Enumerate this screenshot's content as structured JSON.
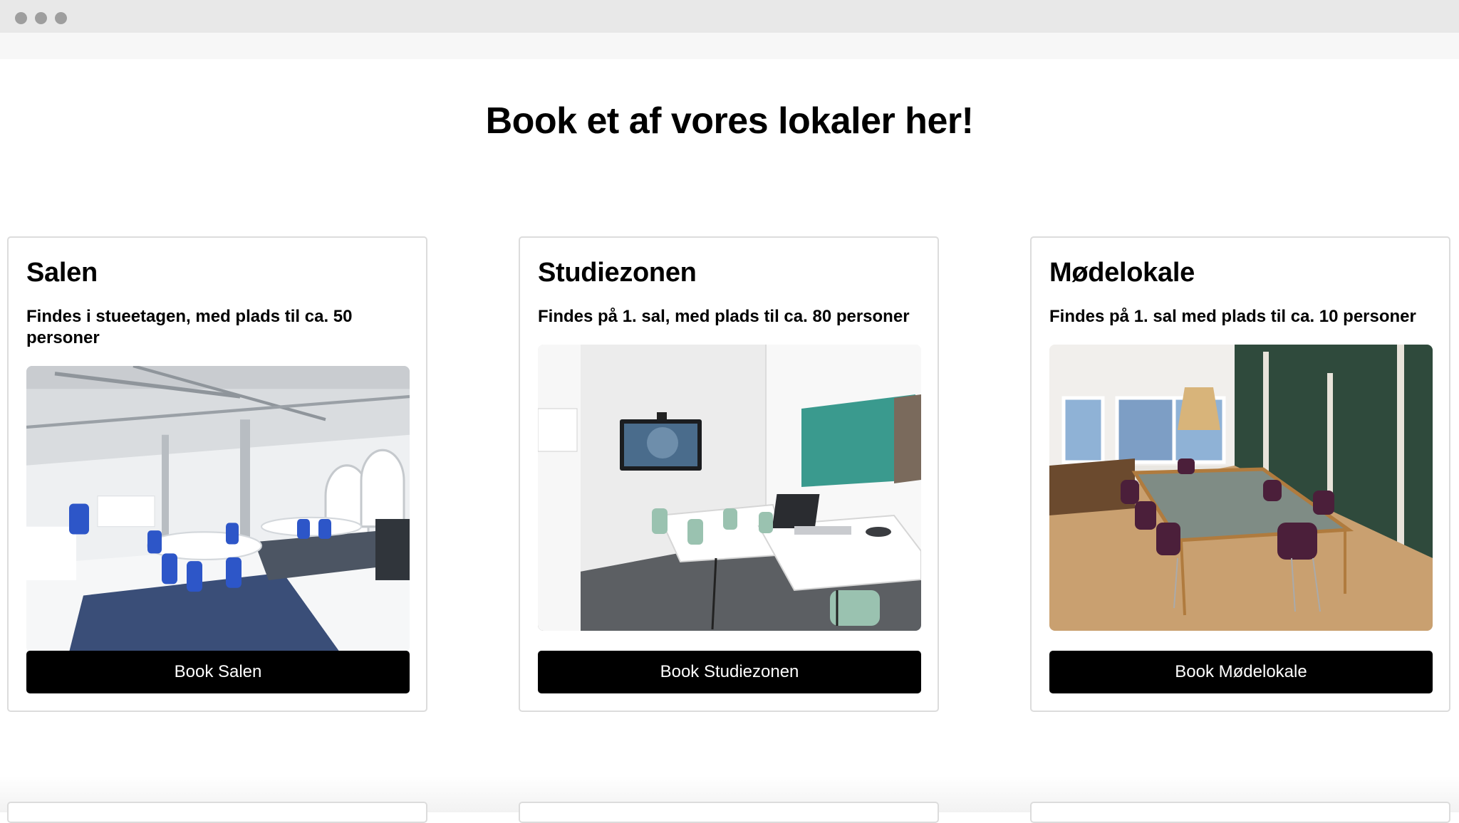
{
  "page": {
    "title": "Book et af vores lokaler her!"
  },
  "rooms": [
    {
      "name": "Salen",
      "description": "Findes i stueetagen, med plads til ca. 50 personer",
      "button": "Book Salen",
      "image_icon": "event-hall-photo"
    },
    {
      "name": "Studiezonen",
      "description": "Findes på 1. sal, med plads til ca. 80 personer",
      "button": "Book Studiezonen",
      "image_icon": "study-room-photo"
    },
    {
      "name": "Mødelokale",
      "description": "Findes på 1. sal med plads til ca. 10 personer",
      "button": "Book Mødelokale",
      "image_icon": "meeting-room-photo"
    }
  ],
  "colors": {
    "button_bg": "#000000",
    "button_text": "#ffffff",
    "card_border": "#dcdcdc"
  }
}
